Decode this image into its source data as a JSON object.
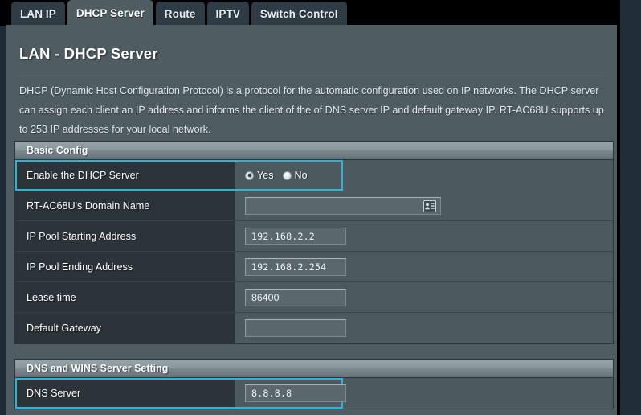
{
  "tabs": [
    {
      "label": "LAN IP",
      "active": false
    },
    {
      "label": "DHCP Server",
      "active": true
    },
    {
      "label": "Route",
      "active": false
    },
    {
      "label": "IPTV",
      "active": false
    },
    {
      "label": "Switch Control",
      "active": false
    }
  ],
  "page": {
    "title": "LAN - DHCP Server",
    "description": "DHCP (Dynamic Host Configuration Protocol) is a protocol for the automatic configuration used on IP networks. The DHCP server can assign each client an IP address and informs the client of the of DNS server IP and default gateway IP. RT-AC68U supports up to 253 IP addresses for your local network."
  },
  "basic_config": {
    "heading": "Basic Config",
    "enable_dhcp": {
      "label": "Enable the DHCP Server",
      "options": [
        {
          "label": "Yes",
          "checked": true
        },
        {
          "label": "No",
          "checked": false
        }
      ]
    },
    "domain_name": {
      "label": "RT-AC68U's Domain Name",
      "value": "",
      "icon": "contact-card-icon"
    },
    "pool_start": {
      "label": "IP Pool Starting Address",
      "value": "192.168.2.2"
    },
    "pool_end": {
      "label": "IP Pool Ending Address",
      "value": "192.168.2.254"
    },
    "lease_time": {
      "label": "Lease time",
      "value": "86400"
    },
    "default_gateway": {
      "label": "Default Gateway",
      "value": ""
    }
  },
  "dns_wins": {
    "heading": "DNS and WINS Server Setting",
    "dns_server": {
      "label": "DNS Server",
      "value": "8.8.8.8"
    }
  },
  "colors": {
    "accent": "#2ab6d9",
    "panel": "#4f5d63",
    "label_cell": "#2b3439",
    "value_cell": "#4c5a60",
    "tab_active": "#4f5d63",
    "tab_inactive": "#2f3c46"
  }
}
